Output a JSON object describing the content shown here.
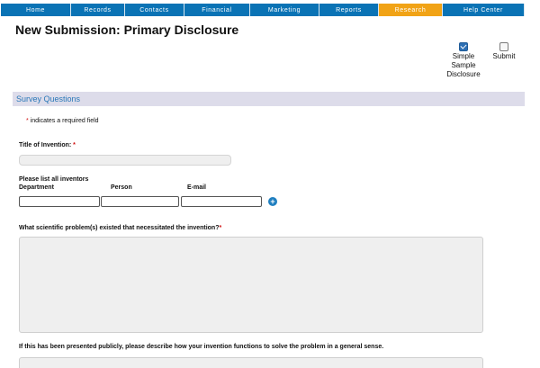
{
  "nav": {
    "items": [
      "Home",
      "Records",
      "Contacts",
      "Financial",
      "Marketing",
      "Reports",
      "Research",
      "Help Center"
    ],
    "active_index": 6
  },
  "page": {
    "title": "New Submission: Primary Disclosure"
  },
  "options": [
    {
      "label": "Simple Sample Disclosure",
      "checked": true
    },
    {
      "label": "Submit",
      "checked": false
    }
  ],
  "section": {
    "title": "Survey Questions"
  },
  "required_note": {
    "star": "*",
    "text": " indicates a required field"
  },
  "fields": {
    "title_label": "Title of Invention:",
    "title_star": " *",
    "inventors_label": "Please list all inventors",
    "inventor_columns": [
      "Department",
      "Person",
      "E-mail"
    ],
    "add_symbol": "+",
    "q1_label": "What scientific problem(s) existed that necessitated the invention?",
    "q1_star": "*",
    "q2_label": "If this has been presented publicly, please describe how your invention functions to solve the problem in a general sense."
  },
  "colors": {
    "nav_bg": "#0a73b5",
    "nav_active": "#f1a316",
    "section_bg": "#dddcea",
    "section_text": "#2b78b8",
    "required_star": "#d01010"
  }
}
